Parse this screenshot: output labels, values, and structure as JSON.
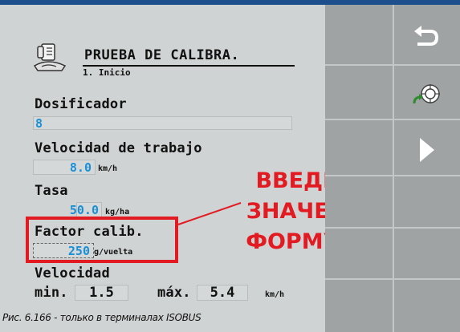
{
  "header": {
    "title": "PRUEBA DE CALIBRA.",
    "subtitle": "1. Inicio",
    "icon": "calibration-scale-icon"
  },
  "fields": {
    "dosificador": {
      "label": "Dosificador",
      "value": "8"
    },
    "velocidad_trabajo": {
      "label": "Velocidad de trabajo",
      "value": "8.0",
      "unit": "km/h"
    },
    "tasa": {
      "label": "Tasa",
      "value": "50.0",
      "unit": "kg/ha"
    },
    "factor_calib": {
      "label": "Factor calib.",
      "value": "250",
      "unit": "g/vuelta"
    },
    "velocidad": {
      "label": "Velocidad",
      "min_label": "min.",
      "min_value": "1.5",
      "max_label": "máx.",
      "max_value": "5.4",
      "unit": "km/h"
    }
  },
  "softkeys": [
    {
      "icon": "return-arrow-icon"
    },
    {
      "icon": "reset-wheel-icon"
    },
    {
      "icon": "next-triangle-icon"
    }
  ],
  "annotation": {
    "line1": "ВВЕДИТЕ",
    "line2": "ЗНАЧЕНИЕ",
    "line3": "ФОРМУЛЫ",
    "color": "#e21b22"
  },
  "caption": "Рис. 6.166 - только в терминалах ISOBUS",
  "colors": {
    "value_blue": "#1a8fd6",
    "top_bar": "#1d4f8c",
    "screen_bg": "#cfd3d3",
    "panel_bg": "#9fa3a4"
  }
}
